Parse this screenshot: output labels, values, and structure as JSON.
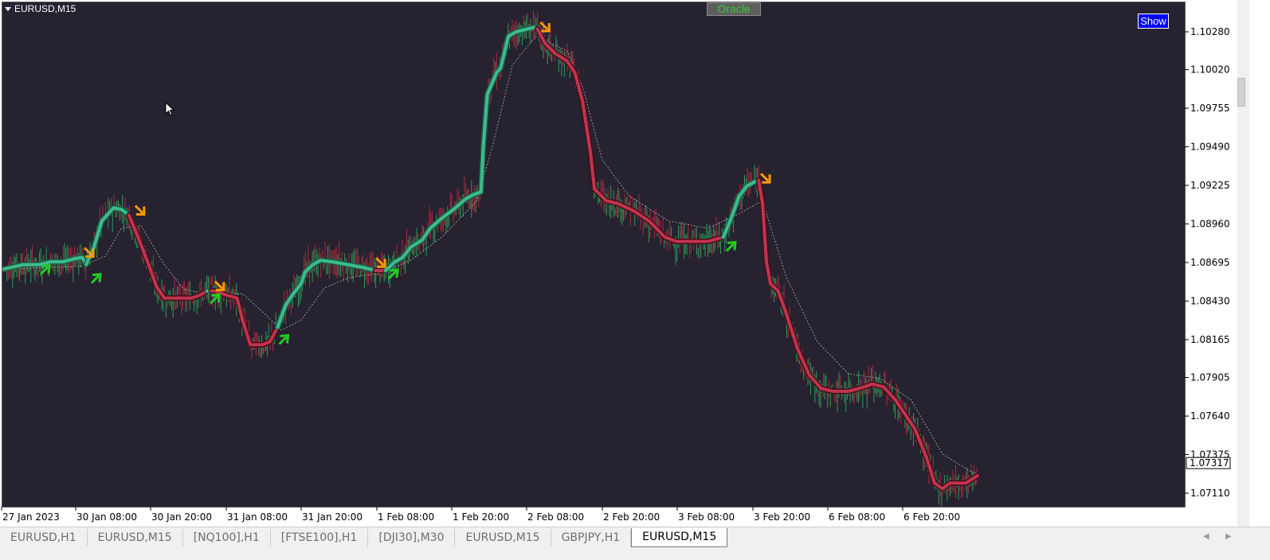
{
  "window": {
    "title": "EURUSD,M15"
  },
  "buttons": {
    "oracle_label": "Oracle",
    "show_label": "Show"
  },
  "colors": {
    "background": "#262230",
    "uptrend_line": "#3dbb8c",
    "downtrend_line": "#c2334d",
    "buy_arrow": "#22cc22",
    "sell_arrow": "#ff9900",
    "bull_candle": "#2f9a55",
    "bear_candle": "#a82c3e",
    "dotted_line": "#b4b4b4"
  },
  "chart_data": {
    "type": "line",
    "symbol": "EURUSD",
    "timeframe": "M15",
    "x_tick_labels": [
      "27 Jan 2023",
      "30 Jan 08:00",
      "30 Jan 20:00",
      "31 Jan 08:00",
      "31 Jan 20:00",
      "1 Feb 08:00",
      "1 Feb 20:00",
      "2 Feb 08:00",
      "2 Feb 20:00",
      "3 Feb 08:00",
      "3 Feb 20:00",
      "6 Feb 08:00",
      "6 Feb 20:00"
    ],
    "y_ticks": [
      1.0711,
      1.07375,
      1.0764,
      1.07905,
      1.08165,
      1.0843,
      1.08695,
      1.0896,
      1.09225,
      1.0949,
      1.09755,
      1.1002,
      1.1028
    ],
    "y_tick_labels": [
      "1.07110",
      "1.07375",
      "1.07640",
      "1.07905",
      "1.08165",
      "1.08430",
      "1.08695",
      "1.08960",
      "1.09225",
      "1.09490",
      "1.09755",
      "1.10020",
      "1.10280"
    ],
    "ylim": [
      1.0706,
      1.1059
    ],
    "xlim": [
      0,
      12.4
    ],
    "current_price": 1.07317,
    "current_price_label": "1.07317",
    "grid": false,
    "series": [
      {
        "name": "Trend line",
        "points": [
          [
            0,
            1.0865
          ],
          [
            0.25,
            1.0868
          ],
          [
            0.45,
            1.0868
          ],
          [
            0.6,
            1.087
          ],
          [
            0.75,
            1.087
          ],
          [
            0.9,
            1.0872
          ],
          [
            1.0,
            1.0873
          ],
          [
            1.05,
            1.0868
          ],
          [
            1.15,
            1.088
          ],
          [
            1.25,
            1.0898
          ],
          [
            1.4,
            1.0907
          ],
          [
            1.5,
            1.0906
          ],
          [
            1.6,
            1.0902
          ],
          [
            1.75,
            1.0882
          ],
          [
            1.85,
            1.0868
          ],
          [
            1.95,
            1.0853
          ],
          [
            2.05,
            1.0845
          ],
          [
            2.2,
            1.0845
          ],
          [
            2.4,
            1.0845
          ],
          [
            2.5,
            1.0847
          ],
          [
            2.6,
            1.085
          ],
          [
            2.7,
            1.085
          ],
          [
            2.85,
            1.0847
          ],
          [
            2.98,
            1.0845
          ],
          [
            3.05,
            1.083
          ],
          [
            3.15,
            1.0813
          ],
          [
            3.3,
            1.0813
          ],
          [
            3.4,
            1.0815
          ],
          [
            3.5,
            1.0825
          ],
          [
            3.6,
            1.084
          ],
          [
            3.7,
            1.0848
          ],
          [
            3.8,
            1.0855
          ],
          [
            3.85,
            1.0863
          ],
          [
            3.95,
            1.0868
          ],
          [
            4.05,
            1.0871
          ],
          [
            4.2,
            1.087
          ],
          [
            4.4,
            1.0868
          ],
          [
            4.6,
            1.0866
          ],
          [
            4.75,
            1.0864
          ],
          [
            4.88,
            1.0864
          ],
          [
            5.0,
            1.087
          ],
          [
            5.1,
            1.0873
          ],
          [
            5.2,
            1.088
          ],
          [
            5.35,
            1.0885
          ],
          [
            5.45,
            1.0893
          ],
          [
            5.6,
            1.09
          ],
          [
            5.75,
            1.0906
          ],
          [
            5.9,
            1.0913
          ],
          [
            6.0,
            1.0916
          ],
          [
            6.1,
            1.0918
          ],
          [
            6.13,
            1.095
          ],
          [
            6.18,
            1.0985
          ],
          [
            6.3,
            1.1
          ],
          [
            6.35,
            1.1003
          ],
          [
            6.45,
            1.1025
          ],
          [
            6.55,
            1.1028
          ],
          [
            6.7,
            1.103
          ],
          [
            6.78,
            1.1031
          ],
          [
            6.82,
            1.103
          ],
          [
            6.92,
            1.102
          ],
          [
            7.05,
            1.1013
          ],
          [
            7.2,
            1.1008
          ],
          [
            7.3,
            1.1
          ],
          [
            7.4,
            1.098
          ],
          [
            7.5,
            1.0945
          ],
          [
            7.55,
            1.092
          ],
          [
            7.7,
            1.0912
          ],
          [
            7.85,
            1.091
          ],
          [
            8.05,
            1.0905
          ],
          [
            8.25,
            1.0898
          ],
          [
            8.45,
            1.0887
          ],
          [
            8.6,
            1.0884
          ],
          [
            8.8,
            1.0884
          ],
          [
            9.0,
            1.0884
          ],
          [
            9.2,
            1.0887
          ],
          [
            9.3,
            1.09
          ],
          [
            9.4,
            1.0915
          ],
          [
            9.5,
            1.0922
          ],
          [
            9.6,
            1.0925
          ],
          [
            9.65,
            1.0926
          ],
          [
            9.7,
            1.091
          ],
          [
            9.75,
            1.087
          ],
          [
            9.8,
            1.0855
          ],
          [
            9.9,
            1.085
          ],
          [
            10.0,
            1.0835
          ],
          [
            10.15,
            1.081
          ],
          [
            10.3,
            1.0792
          ],
          [
            10.45,
            1.0783
          ],
          [
            10.6,
            1.0781
          ],
          [
            10.8,
            1.0781
          ],
          [
            11.0,
            1.0784
          ],
          [
            11.1,
            1.0786
          ],
          [
            11.25,
            1.0784
          ],
          [
            11.4,
            1.0775
          ],
          [
            11.55,
            1.0763
          ],
          [
            11.65,
            1.0755
          ],
          [
            11.8,
            1.0735
          ],
          [
            11.9,
            1.0718
          ],
          [
            12.0,
            1.0714
          ],
          [
            12.1,
            1.0718
          ],
          [
            12.3,
            1.0718
          ],
          [
            12.45,
            1.0723
          ]
        ],
        "segments": [
          {
            "from": 0,
            "to": 1.05,
            "trend": "up"
          },
          {
            "from": 1.05,
            "to": 1.6,
            "trend": "up"
          },
          {
            "from": 1.6,
            "to": 2.6,
            "trend": "down"
          },
          {
            "from": 2.6,
            "to": 2.65,
            "trend": "up"
          },
          {
            "from": 2.65,
            "to": 3.5,
            "trend": "down"
          },
          {
            "from": 3.5,
            "to": 4.75,
            "trend": "up"
          },
          {
            "from": 4.75,
            "to": 4.88,
            "trend": "down"
          },
          {
            "from": 4.88,
            "to": 6.82,
            "trend": "up"
          },
          {
            "from": 6.82,
            "to": 9.2,
            "trend": "down"
          },
          {
            "from": 9.2,
            "to": 9.65,
            "trend": "up"
          },
          {
            "from": 9.65,
            "to": 12.45,
            "trend": "down"
          }
        ]
      },
      {
        "name": "Dotted line",
        "points": [
          [
            0,
            1.0865
          ],
          [
            0.5,
            1.0866
          ],
          [
            1.0,
            1.0867
          ],
          [
            1.3,
            1.0874
          ],
          [
            1.5,
            1.0893
          ],
          [
            1.75,
            1.0895
          ],
          [
            2.05,
            1.0868
          ],
          [
            2.3,
            1.0851
          ],
          [
            2.6,
            1.0848
          ],
          [
            3.05,
            1.0848
          ],
          [
            3.3,
            1.0836
          ],
          [
            3.55,
            1.0823
          ],
          [
            3.8,
            1.083
          ],
          [
            4.1,
            1.0852
          ],
          [
            4.4,
            1.0859
          ],
          [
            4.8,
            1.0862
          ],
          [
            5.2,
            1.0871
          ],
          [
            5.6,
            1.0887
          ],
          [
            6.05,
            1.0912
          ],
          [
            6.25,
            1.095
          ],
          [
            6.5,
            1.1005
          ],
          [
            6.8,
            1.1025
          ],
          [
            7.2,
            1.1015
          ],
          [
            7.4,
            1.099
          ],
          [
            7.65,
            1.094
          ],
          [
            8.0,
            1.0915
          ],
          [
            8.5,
            1.0898
          ],
          [
            9.0,
            1.0893
          ],
          [
            9.4,
            1.0903
          ],
          [
            9.7,
            1.0912
          ],
          [
            10.0,
            1.086
          ],
          [
            10.4,
            1.0815
          ],
          [
            10.8,
            1.0793
          ],
          [
            11.2,
            1.079
          ],
          [
            11.6,
            1.0775
          ],
          [
            12.0,
            1.0738
          ],
          [
            12.45,
            1.0723
          ]
        ]
      }
    ],
    "signals": [
      {
        "type": "buy",
        "x": 0.45,
        "y": 1.0868
      },
      {
        "type": "sell",
        "x": 1.05,
        "y": 1.0873
      },
      {
        "type": "buy",
        "x": 1.1,
        "y": 1.0862
      },
      {
        "type": "sell",
        "x": 1.7,
        "y": 1.0902
      },
      {
        "type": "buy",
        "x": 2.62,
        "y": 1.0848
      },
      {
        "type": "sell",
        "x": 2.72,
        "y": 1.085
      },
      {
        "type": "buy",
        "x": 3.5,
        "y": 1.082
      },
      {
        "type": "sell",
        "x": 4.78,
        "y": 1.0866
      },
      {
        "type": "buy",
        "x": 4.9,
        "y": 1.0865
      },
      {
        "type": "sell",
        "x": 6.88,
        "y": 1.1028
      },
      {
        "type": "buy",
        "x": 9.22,
        "y": 1.0884
      },
      {
        "type": "sell",
        "x": 9.7,
        "y": 1.0924
      }
    ]
  },
  "tabs": [
    {
      "label": "EURUSD,H1",
      "active": false
    },
    {
      "label": "EURUSD,M15",
      "active": false
    },
    {
      "label": "[NQ100],H1",
      "active": false
    },
    {
      "label": "[FTSE100],H1",
      "active": false
    },
    {
      "label": "[DJI30],M30",
      "active": false
    },
    {
      "label": "EURUSD,M15",
      "active": false
    },
    {
      "label": "GBPJPY,H1",
      "active": false
    },
    {
      "label": "EURUSD,M15",
      "active": true
    }
  ]
}
